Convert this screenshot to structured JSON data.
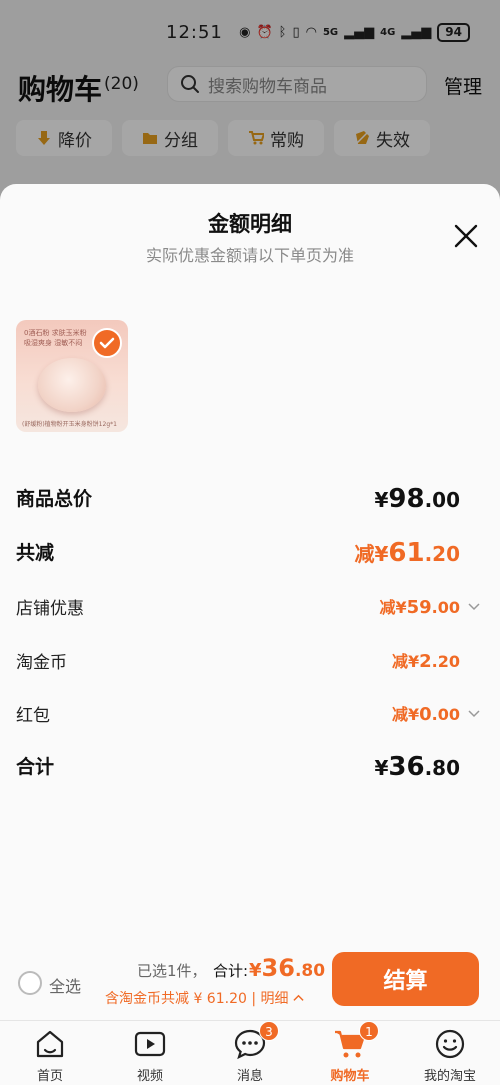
{
  "status_bar": {
    "time": "12:51",
    "signal1": "5G",
    "signal2": "4G",
    "battery": "94"
  },
  "cart": {
    "title": "购物车",
    "count": "(20)",
    "search_placeholder": "搜索购物车商品",
    "manage": "管理",
    "filters": [
      {
        "label": "降价",
        "icon": "price-down-icon"
      },
      {
        "label": "分组",
        "icon": "folder-icon"
      },
      {
        "label": "常购",
        "icon": "cart-icon"
      },
      {
        "label": "失效",
        "icon": "invalid-icon"
      }
    ]
  },
  "sheet": {
    "title": "金额明细",
    "subtitle": "实际优惠金额请以下单页为准",
    "product": {
      "line1": "0酒石粉 求肤玉米粉",
      "line2": "吸湿爽身 湿敏不闷",
      "caption": "(舒缓粉)植物粉开玉米身粉饼12g*1"
    },
    "rows": [
      {
        "label": "商品总价",
        "prefix": "",
        "symbol": "¥",
        "int": "98",
        "dec": ".00"
      },
      {
        "label": "共减",
        "prefix": "减",
        "symbol": "¥",
        "int": "61",
        "dec": ".20"
      },
      {
        "label": "店铺优惠",
        "prefix": "减",
        "symbol": "¥",
        "int": "59",
        "dec": ".00"
      },
      {
        "label": "淘金币",
        "prefix": "减",
        "symbol": "¥",
        "int": "2",
        "dec": ".20"
      },
      {
        "label": "红包",
        "prefix": "减",
        "symbol": "¥",
        "int": "0",
        "dec": ".00"
      },
      {
        "label": "合计",
        "prefix": "",
        "symbol": "¥",
        "int": "36",
        "dec": ".80"
      }
    ]
  },
  "checkout": {
    "select_all": "全选",
    "selected": "已选1件，",
    "total_label": "合计:",
    "total_symbol": "¥",
    "total_int": "36",
    "total_dec": ".80",
    "coin_line": "含淘金币共减 ¥ 61.20 | 明细",
    "button": "结算"
  },
  "tabbar": [
    {
      "label": "首页",
      "icon": "home-icon"
    },
    {
      "label": "视频",
      "icon": "video-icon"
    },
    {
      "label": "消息",
      "icon": "message-icon",
      "badge": "3"
    },
    {
      "label": "购物车",
      "icon": "cart-icon",
      "badge": "1",
      "active": true
    },
    {
      "label": "我的淘宝",
      "icon": "profile-icon"
    }
  ],
  "colors": {
    "accent": "#f06a25",
    "text": "#111111",
    "muted": "#8a8a8a"
  }
}
